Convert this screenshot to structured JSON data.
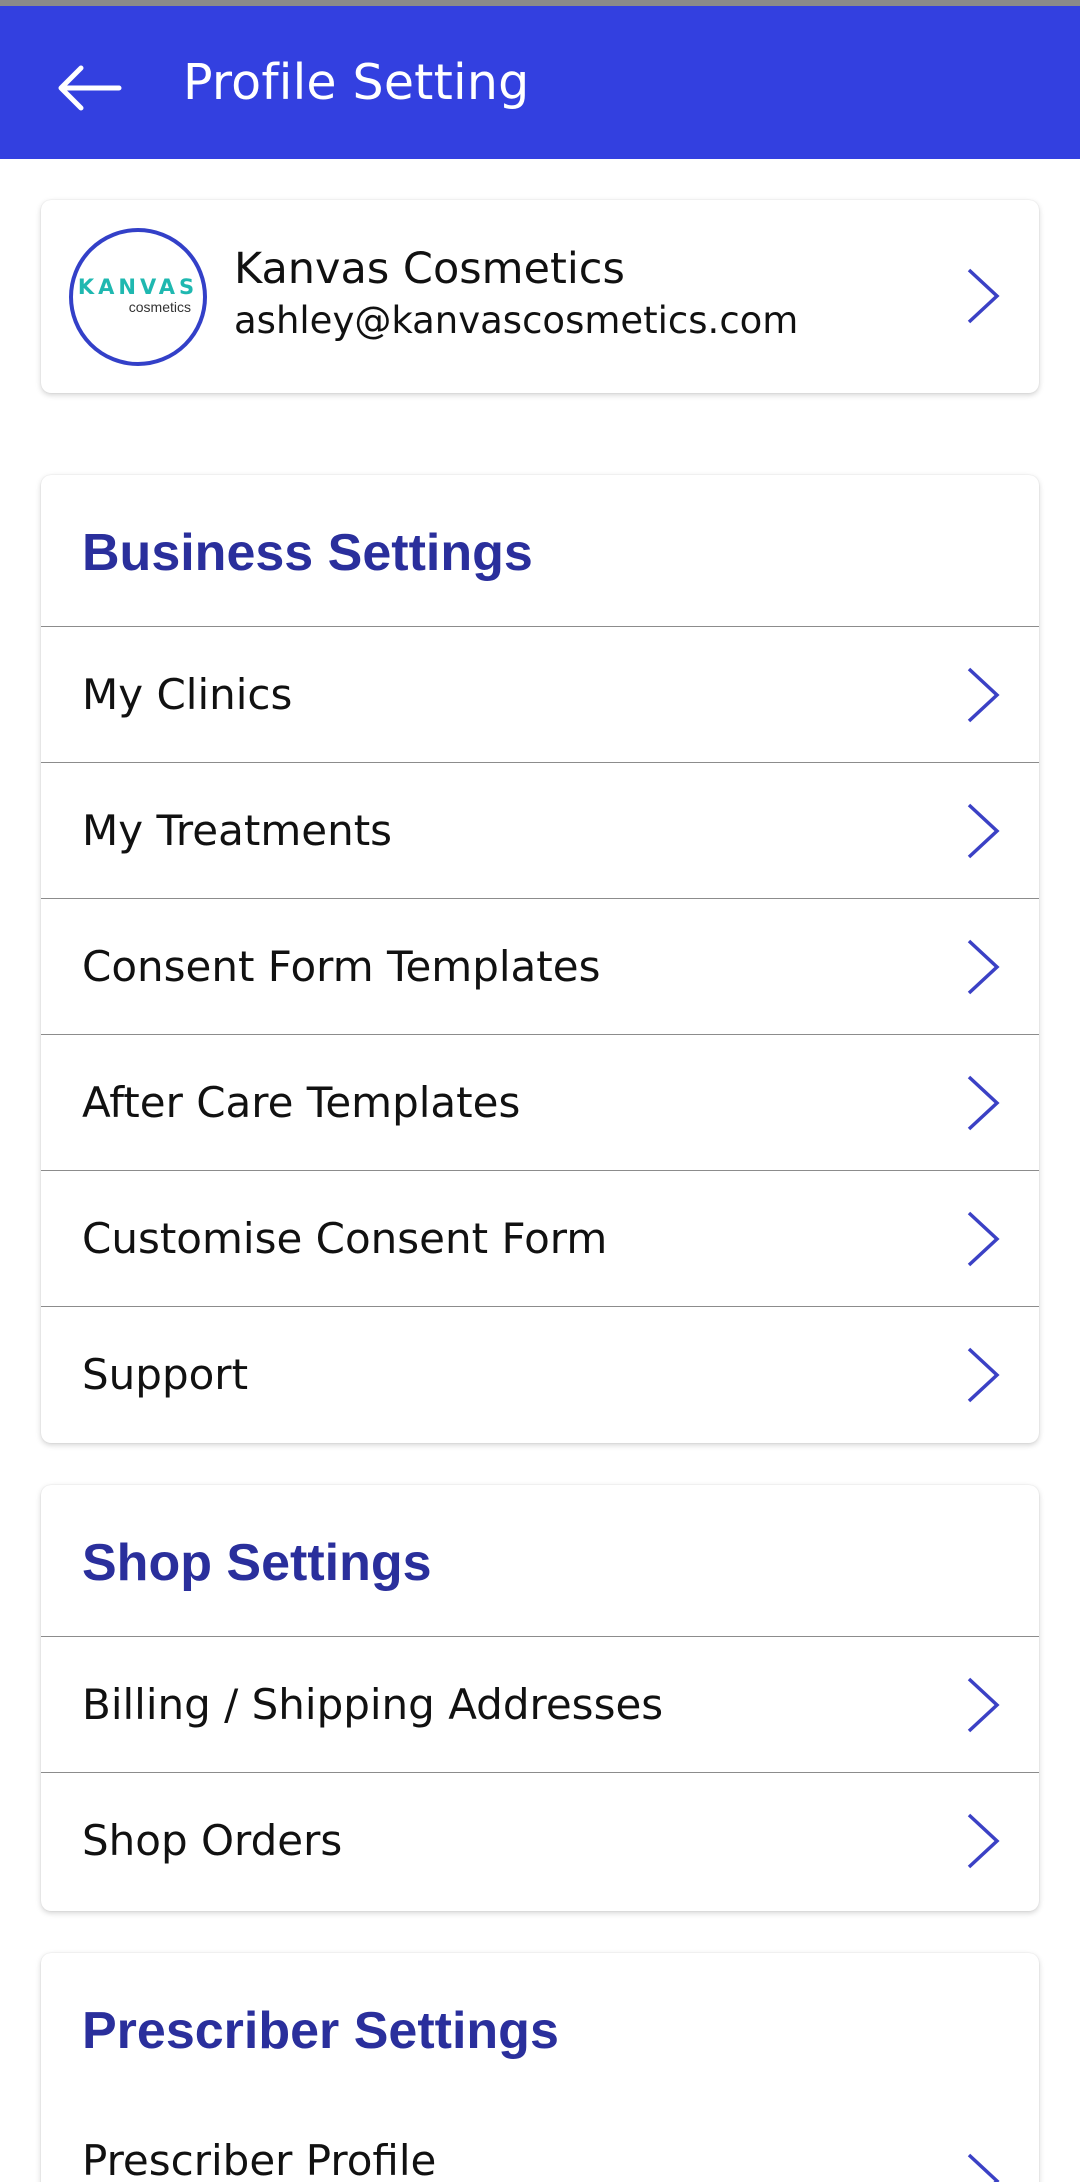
{
  "app_bar": {
    "title": "Profile Setting",
    "back_icon": "arrow-left-icon",
    "color": "#3340e0"
  },
  "profile": {
    "name": "Kanvas Cosmetics",
    "email": "ashley@kanvascosmetics.com",
    "logo_text": "KANVAS",
    "logo_subtext": "cosmetics"
  },
  "sections": {
    "business": {
      "title": "Business Settings",
      "items": [
        {
          "label": "My Clinics"
        },
        {
          "label": "My Treatments"
        },
        {
          "label": "Consent Form Templates"
        },
        {
          "label": "After Care Templates"
        },
        {
          "label": "Customise Consent Form"
        },
        {
          "label": "Support"
        }
      ]
    },
    "shop": {
      "title": "Shop Settings",
      "items": [
        {
          "label": "Billing / Shipping Addresses"
        },
        {
          "label": "Shop Orders"
        }
      ]
    },
    "prescriber": {
      "title": "Prescriber Settings",
      "items": [
        {
          "label": "Prescriber Profile"
        }
      ]
    }
  },
  "colors": {
    "accent": "#2a2f9c",
    "chevron": "#3b41c5",
    "logo_teal": "#1fb8b0"
  },
  "icons": {
    "row_chevron": "chevron-right-icon"
  }
}
